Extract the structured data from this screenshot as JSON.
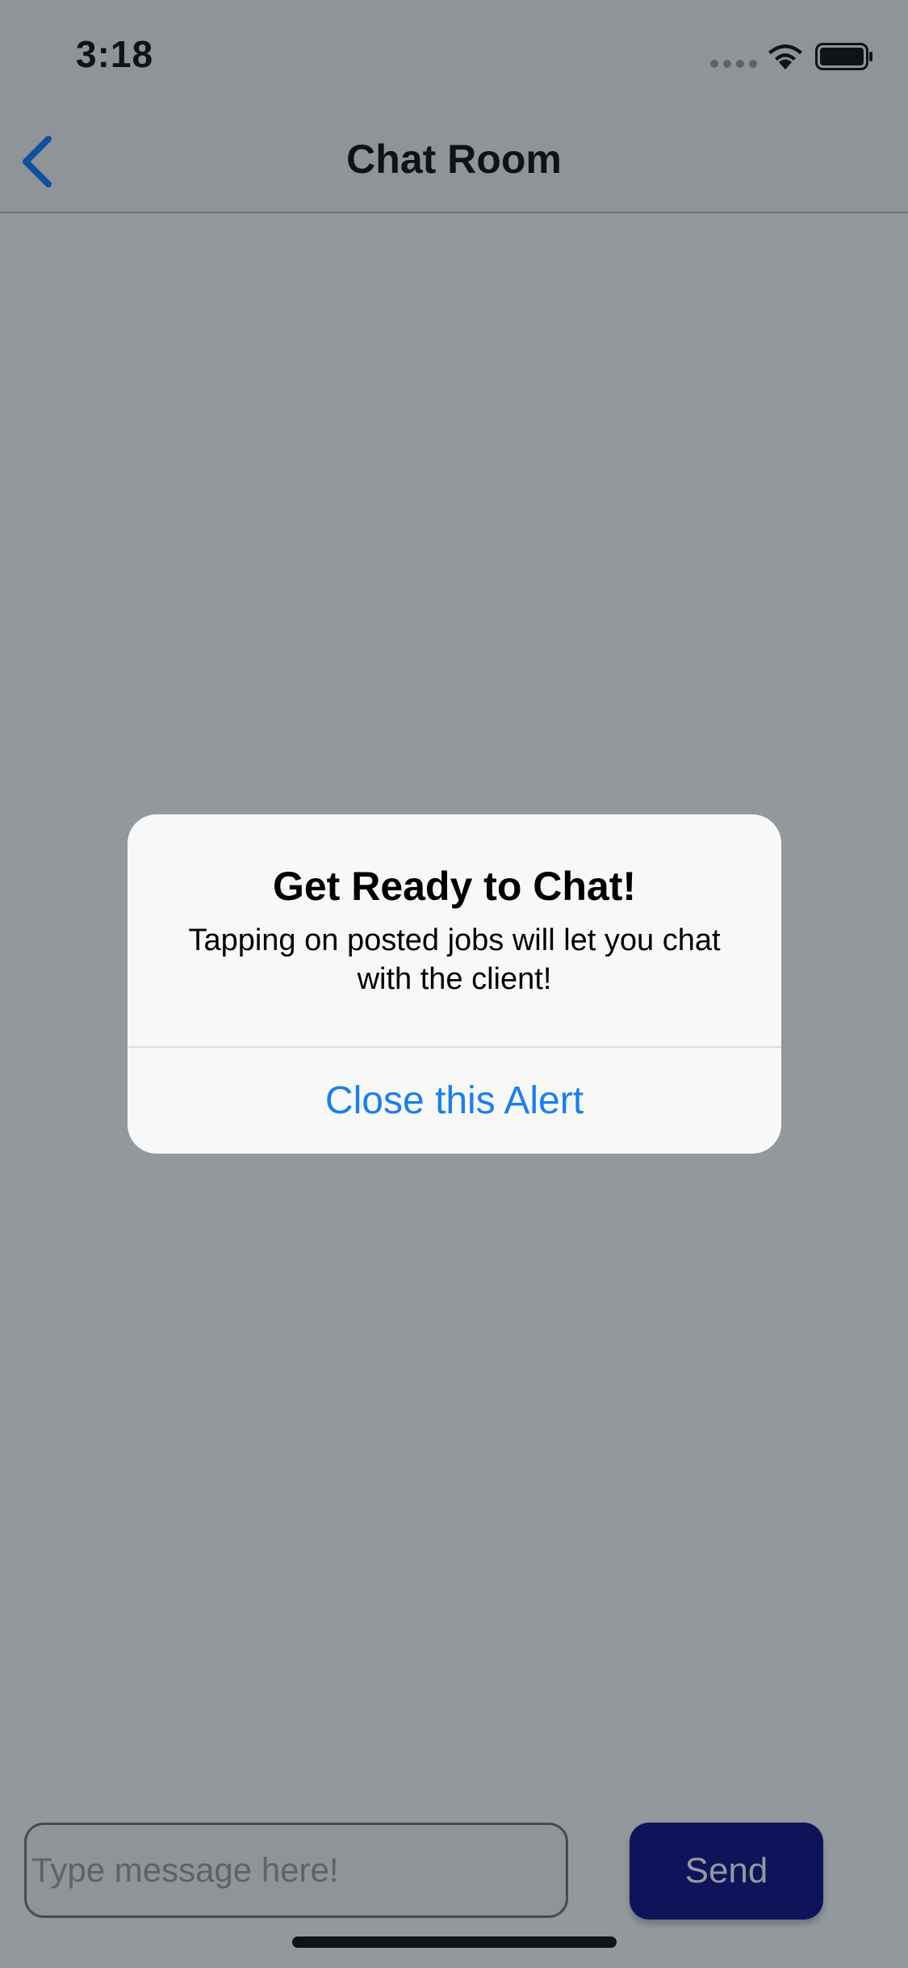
{
  "status_bar": {
    "time": "3:18",
    "signal_icon": "cellular-dots-icon",
    "wifi_icon": "wifi-icon",
    "battery_icon": "battery-full-icon"
  },
  "nav": {
    "back_icon": "chevron-left-icon",
    "title": "Chat Room"
  },
  "composer": {
    "placeholder": "Type message here!",
    "value": "",
    "send_label": "Send"
  },
  "alert": {
    "title": "Get Ready to Chat!",
    "message": "Tapping on posted jobs will let you chat with the client!",
    "button_label": "Close this Alert"
  },
  "colors": {
    "send_button": "#00007f",
    "alert_button_text": "#1a7ff0",
    "overlay": "rgba(30, 40, 50, 0.48)"
  }
}
